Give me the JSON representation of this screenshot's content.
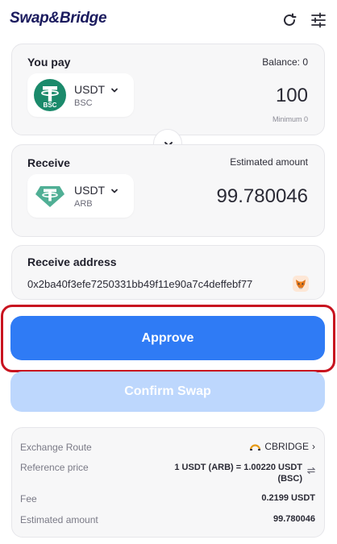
{
  "app": {
    "title": "Swap&Bridge"
  },
  "header": {
    "refresh_icon": "refresh-icon",
    "settings_icon": "sliders-icon"
  },
  "pay": {
    "title": "You pay",
    "balance": "Balance: 0",
    "token": {
      "symbol": "USDT",
      "network": "BSC",
      "icon": "tether-bsc-icon",
      "color": "#1b8a6b"
    },
    "amount": "100",
    "minimum": "Minimum 0"
  },
  "swap_toggle": {
    "icon": "chevron-down-icon"
  },
  "receive": {
    "title": "Receive",
    "estimated_label": "Estimated amount",
    "token": {
      "symbol": "USDT",
      "network": "ARB",
      "icon": "tether-icon",
      "color": "#50af95"
    },
    "amount": "99.780046"
  },
  "receive_address": {
    "title": "Receive address",
    "address": "0x2ba40f3efe7250331bb49f11e90a7c4deffebf77",
    "wallet_icon": "metamask-fox-icon"
  },
  "actions": {
    "approve_label": "Approve",
    "confirm_label": "Confirm Swap",
    "primary_color": "#2f7bf5",
    "disabled_color": "#bdd7fd",
    "highlight_color": "#c8131f"
  },
  "details": {
    "route_label": "Exchange Route",
    "route_value": "CBRIDGE",
    "route_icon": "cbridge-icon",
    "price_label": "Reference price",
    "price_value": "1 USDT (ARB) = 1.00220 USDT (BSC)",
    "fee_label": "Fee",
    "fee_value": "0.2199 USDT",
    "estimated_label": "Estimated amount",
    "estimated_value": "99.780046"
  }
}
